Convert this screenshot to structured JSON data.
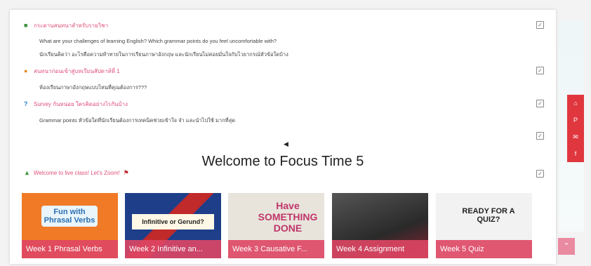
{
  "items": [
    {
      "title": "กระดานสนทนาสำหรับรายวิชา",
      "icon": "forum-icon"
    },
    {
      "title": "สนทนาก่อนเข้าสู่บทเรียนสัปดาห์ที่ 1",
      "icon": "chat-icon"
    },
    {
      "title": "Survey กันหน่อย ใครคิดอย่างไรกันบ้าง",
      "icon": "question-icon"
    },
    {
      "title": "Welcome to live class! Let's Zoom!",
      "icon": "plant-icon"
    }
  ],
  "descriptions": [
    "What are your challenges of learning English? Which grammar points do you feel uncomfortable with?",
    "นักเรียนคิดว่า อะไรคือความท้าทายในการเรียนภาษาอังกฤษ และนักเรียนไม่ค่อยมั่นใจกับไวยากรณ์หัวข้อใดบ้าง",
    "ห้องเรียนภาษาอังกฤษแบบไหนที่คุณต้องการ???",
    "Grammar points หัวข้อใดที่นักเรียนต้องการเทคนิคช่วยเข้าใจ จำ และนำไปใช้ มากที่สุด"
  ],
  "welcome": "Welcome to Focus Time 5",
  "tiles": [
    {
      "label": "Week 1 Phrasal Verbs",
      "image_text": "Fun with Phrasal Verbs"
    },
    {
      "label": "Week 2 Infinitive an...",
      "image_text": "Infinitive or Gerund?"
    },
    {
      "label": "Week 3 Causative F...",
      "image_text": "Have SOMETHING DONE"
    },
    {
      "label": "Week 4 Assignment",
      "image_text": ""
    },
    {
      "label": "Week 5 Quiz",
      "image_text": "READY FOR A QUIZ?"
    }
  ],
  "social": [
    "home-icon",
    "pinterest-icon",
    "mail-icon",
    "facebook-icon"
  ]
}
